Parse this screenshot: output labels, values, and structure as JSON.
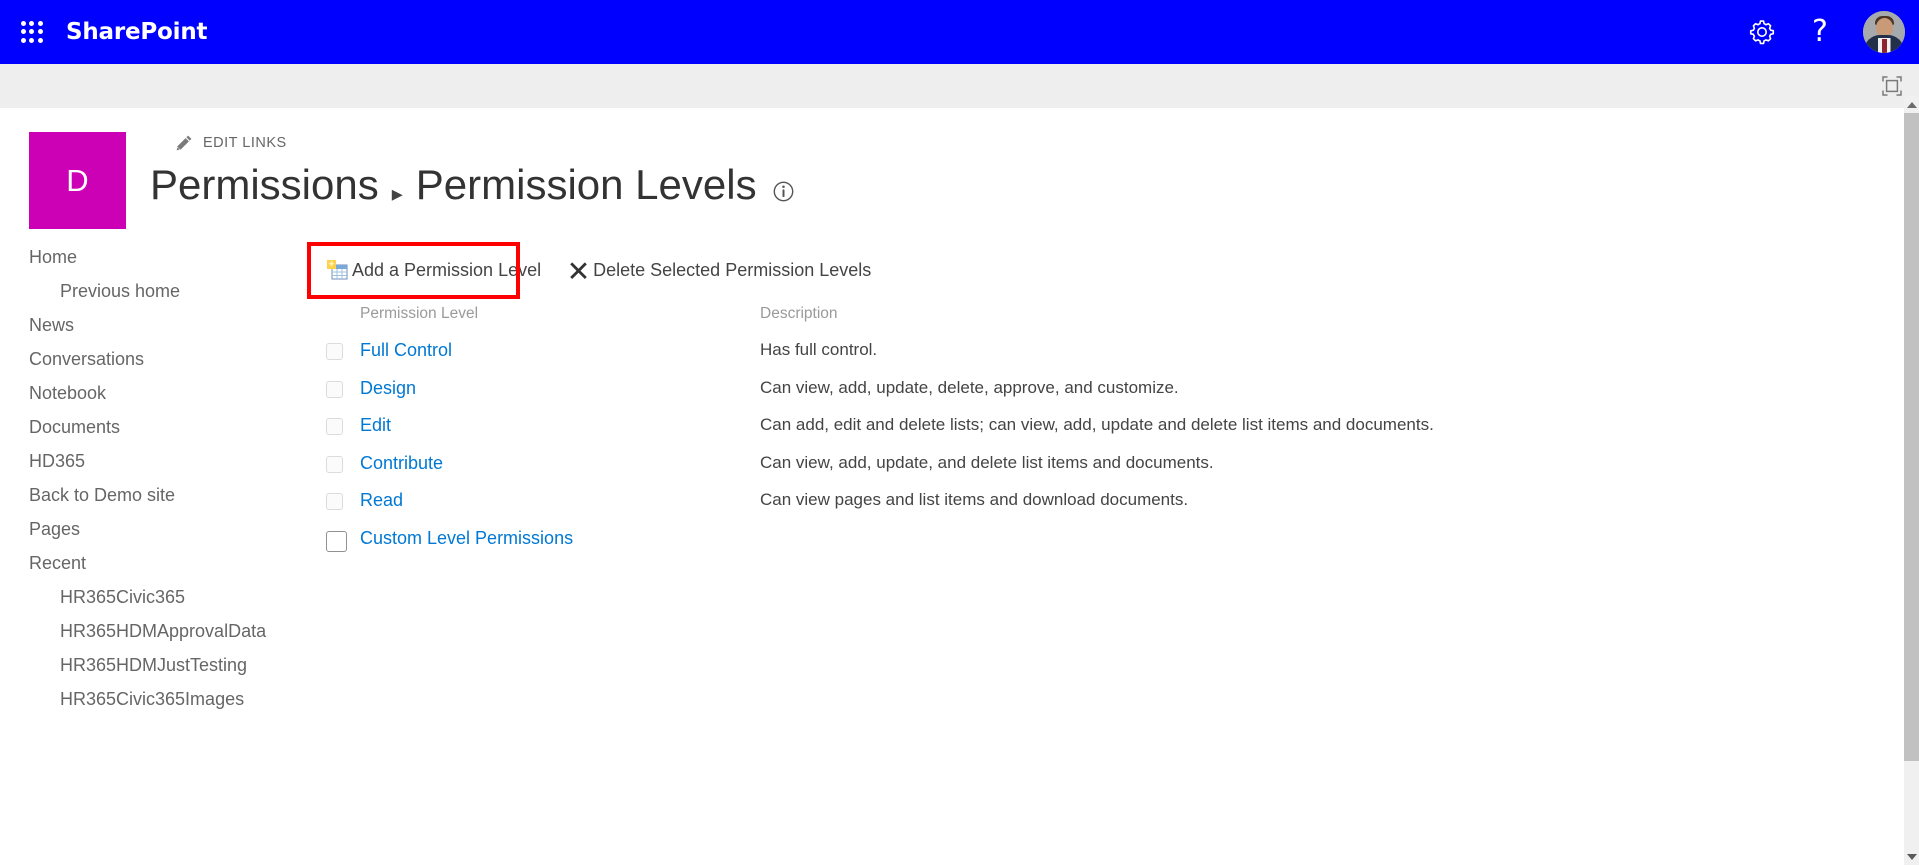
{
  "suite": {
    "waffle_label": "app-launcher",
    "brand": "SharePoint",
    "settings_icon": "gear-icon",
    "help_label": "?",
    "avatar_label": "user-avatar"
  },
  "second_bar": {
    "focus_icon": "focus-on-content-icon"
  },
  "site": {
    "logo_letter": "D",
    "edit_links_label": "EDIT LINKS",
    "edit_links_icon": "pencil-icon"
  },
  "title": {
    "parent": "Permissions",
    "separator": "▸",
    "current": "Permission Levels",
    "info_icon": "info-icon"
  },
  "nav": {
    "items": [
      {
        "label": "Home",
        "child": false
      },
      {
        "label": "Previous home",
        "child": true
      },
      {
        "label": "News",
        "child": false
      },
      {
        "label": "Conversations",
        "child": false
      },
      {
        "label": "Notebook",
        "child": false
      },
      {
        "label": "Documents",
        "child": false
      },
      {
        "label": "HD365",
        "child": false
      },
      {
        "label": "Back to Demo site",
        "child": false
      },
      {
        "label": "Pages",
        "child": false
      },
      {
        "label": "Recent",
        "child": false
      },
      {
        "label": "HR365Civic365",
        "child": true
      },
      {
        "label": "HR365HDMApprovalData",
        "child": true
      },
      {
        "label": "HR365HDMJustTesting",
        "child": true
      },
      {
        "label": "HR365Civic365Images",
        "child": true
      }
    ]
  },
  "toolbar": {
    "add_label": "Add a Permission Level",
    "add_icon": "new-permission-level-icon",
    "delete_label": "Delete Selected Permission Levels",
    "delete_icon": "delete-x-icon",
    "highlight_color": "#ff0000"
  },
  "table": {
    "headers": {
      "check": "",
      "name": "Permission Level",
      "description": "Description"
    },
    "rows": [
      {
        "name": "Full Control",
        "description": "Has full control.",
        "checked": false,
        "strong_checkbox": false
      },
      {
        "name": "Design",
        "description": "Can view, add, update, delete, approve, and customize.",
        "checked": false,
        "strong_checkbox": false
      },
      {
        "name": "Edit",
        "description": "Can add, edit and delete lists; can view, add, update and delete list items and documents.",
        "checked": false,
        "strong_checkbox": false
      },
      {
        "name": "Contribute",
        "description": "Can view, add, update, and delete list items and documents.",
        "checked": false,
        "strong_checkbox": false
      },
      {
        "name": "Read",
        "description": "Can view pages and list items and download documents.",
        "checked": false,
        "strong_checkbox": false
      },
      {
        "name": "Custom Level Permissions",
        "description": "",
        "checked": false,
        "strong_checkbox": true
      }
    ]
  },
  "colors": {
    "suite_bar": "#0000ff",
    "second_bar": "#efeeee",
    "site_logo": "#cc00b4",
    "link": "#0078d4",
    "highlight": "#ff0000"
  }
}
